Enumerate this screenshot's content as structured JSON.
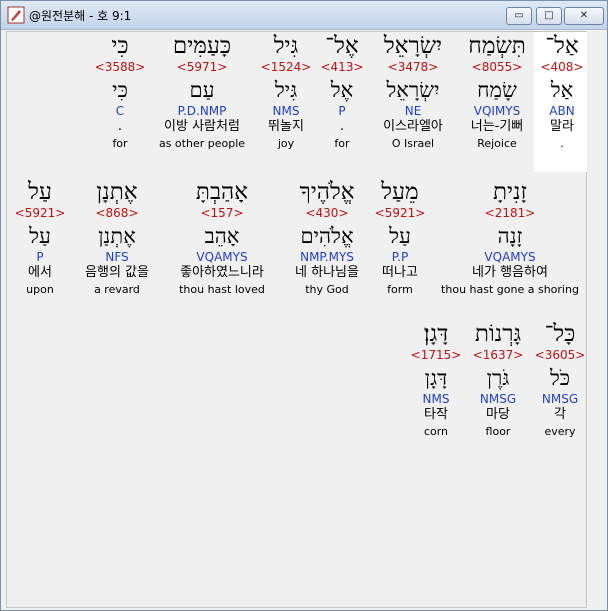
{
  "window": {
    "title": "@원전분해 - 호 9:1",
    "minimize": "▭",
    "maximize": "□",
    "close": "✕"
  },
  "rows": [
    {
      "words": [
        {
          "heb": "אַל־",
          "strong": "<408>",
          "root": "אַל",
          "parse": "ABN",
          "ko": "말라",
          "en": ".",
          "hl": true
        },
        {
          "heb": "תִּשְׂמַח",
          "strong": "<8055>",
          "root": "שָׂמַח",
          "parse": "VQIMYS",
          "ko": "너는-기뻐",
          "en": "Rejoice"
        },
        {
          "heb": "יִשְׂרָאֵל",
          "strong": "<3478>",
          "root": "יִשְׂרָאֵל",
          "parse": "NE",
          "ko": "이스라엘아",
          "en": "O Israel"
        },
        {
          "heb": "אֶל־",
          "strong": "<413>",
          "root": "אֶל",
          "parse": "P",
          "ko": ".",
          "en": "for"
        },
        {
          "heb": "גִּיל",
          "strong": "<1524>",
          "root": "גִּיל",
          "parse": "NMS",
          "ko": "뛰놀지",
          "en": "joy"
        },
        {
          "heb": "כָּעַמִּים",
          "strong": "<5971>",
          "root": "עַם",
          "parse": "P.D.NMP",
          "ko": "이방 사람처럼",
          "en": "as other people"
        },
        {
          "heb": "כִּי",
          "strong": "<3588>",
          "root": "כִּי",
          "parse": "C",
          "ko": ".",
          "en": "for"
        }
      ]
    },
    {
      "words": [
        {
          "heb": "זָנִיתָ",
          "strong": "<2181>",
          "root": "זָנָה",
          "parse": "VQAMYS",
          "ko": "네가 행음하여",
          "en": "thou hast gone a shoring"
        },
        {
          "heb": "מֵעַל",
          "strong": "<5921>",
          "root": "עַל",
          "parse": "P.P",
          "ko": "떠나고",
          "en": "form"
        },
        {
          "heb": "אֱלֹהֶיךָ",
          "strong": "<430>",
          "root": "אֱלֹהִים",
          "parse": "NMP.MYS",
          "ko": "네 하나님을",
          "en": "thy God"
        },
        {
          "heb": "אָהַבְתָּ",
          "strong": "<157>",
          "root": "אָהֵב",
          "parse": "VQAMYS",
          "ko": "좋아하였느니라",
          "en": "thou hast loved"
        },
        {
          "heb": "אֶתְנָן",
          "strong": "<868>",
          "root": "אֶתְנַן",
          "parse": "NFS",
          "ko": "음행의 값을",
          "en": "a revard"
        },
        {
          "heb": "עַל",
          "strong": "<5921>",
          "root": "עַל",
          "parse": "P",
          "ko": "에서",
          "en": "upon"
        }
      ]
    },
    {
      "words": [
        {
          "heb": "כָּל־",
          "strong": "<3605>",
          "root": "כֹּל",
          "parse": "NMSG",
          "ko": "각",
          "en": "every"
        },
        {
          "heb": "גָּרְנוֹת",
          "strong": "<1637>",
          "root": "גֹּרֶן",
          "parse": "NMSG",
          "ko": "마당",
          "en": "floor"
        },
        {
          "heb": "דָּגָן׃",
          "strong": "<1715>",
          "root": "דָּגָן",
          "parse": "NMS",
          "ko": "타작",
          "en": "corn"
        }
      ]
    }
  ]
}
